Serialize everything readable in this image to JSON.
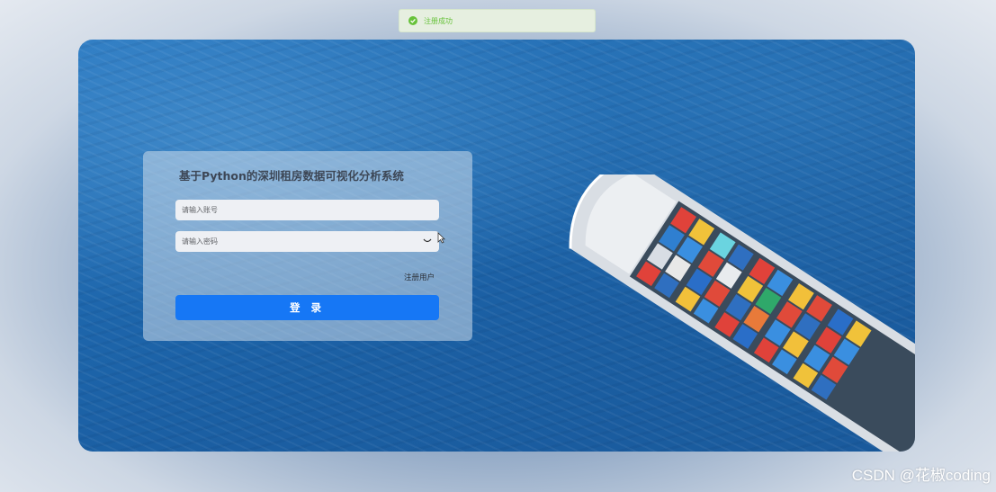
{
  "toast": {
    "message": "注册成功",
    "icon": "check-circle-icon",
    "color": "#67c23a"
  },
  "login": {
    "title": "基于Python的深圳租房数据可视化分析系统",
    "account_placeholder": "请输入账号",
    "password_placeholder": "请输入密码",
    "password_toggle_icon": "eye-closed-icon",
    "register_link": "注册用户",
    "login_button": "登 录",
    "accent": "#1677f5"
  },
  "watermark": "CSDN @花椒coding"
}
